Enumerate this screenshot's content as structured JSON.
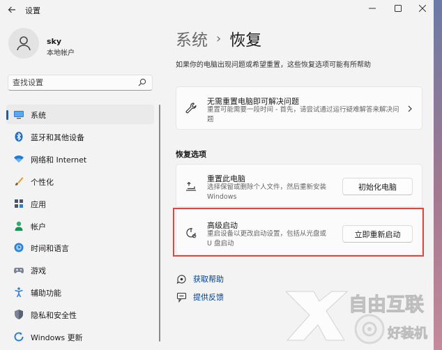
{
  "window": {
    "title": "设置"
  },
  "profile": {
    "name": "sky",
    "account_type": "本地帐户"
  },
  "search": {
    "placeholder": "查找设置"
  },
  "nav": {
    "items": [
      {
        "label": "系统",
        "icon": "system-icon"
      },
      {
        "label": "蓝牙和其他设备",
        "icon": "bluetooth-icon"
      },
      {
        "label": "网络和 Internet",
        "icon": "wifi-icon"
      },
      {
        "label": "个性化",
        "icon": "brush-icon"
      },
      {
        "label": "应用",
        "icon": "apps-icon"
      },
      {
        "label": "帐户",
        "icon": "person-icon"
      },
      {
        "label": "时间和语言",
        "icon": "globe-clock-icon"
      },
      {
        "label": "游戏",
        "icon": "gamepad-icon"
      },
      {
        "label": "辅助功能",
        "icon": "accessibility-icon"
      },
      {
        "label": "隐私和安全性",
        "icon": "shield-icon"
      },
      {
        "label": "Windows 更新",
        "icon": "update-icon"
      }
    ],
    "selected_index": 0
  },
  "main": {
    "breadcrumb_parent": "系统",
    "breadcrumb_separator": "›",
    "breadcrumb_current": "恢复",
    "description": "如果你的电脑出现问题或希望重置，这些恢复选项可能有所帮助",
    "troubleshoot_card": {
      "title": "无需重置电脑即可解决问题",
      "desc": "重置可能需要一段时间 - 首先，请尝试通过运行疑难解答来解决问题",
      "icon": "wrench-icon"
    },
    "section_title": "恢复选项",
    "reset_card": {
      "title": "重置此电脑",
      "desc": "选择保留或删除个人文件，然后重新安装 Windows",
      "button": "初始化电脑",
      "icon": "reset-pc-icon"
    },
    "advanced_card": {
      "title": "高级启动",
      "desc": "重启设备以更改启动设置，包括从光盘或 U 盘启动",
      "button": "立即重新启动",
      "icon": "advanced-startup-icon"
    },
    "links": [
      {
        "label": "获取帮助",
        "icon": "help-icon"
      },
      {
        "label": "提供反馈",
        "icon": "feedback-icon"
      }
    ]
  },
  "watermark": {
    "brand": "自由互联",
    "sub": "好装机"
  },
  "colors": {
    "accent": "#0067c0",
    "highlight": "#e0463f"
  }
}
